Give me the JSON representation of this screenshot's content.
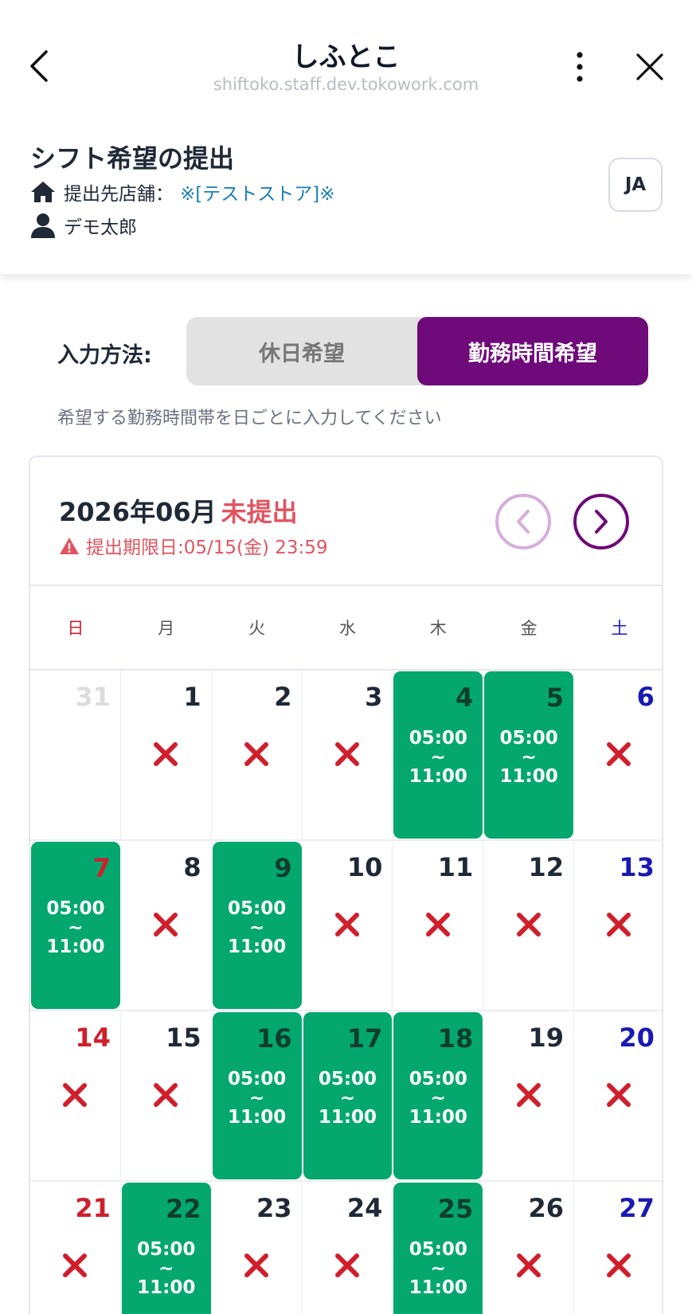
{
  "nav": {
    "title": "しふとこ",
    "url": "shiftoko.staff.dev.tokowork.com"
  },
  "header": {
    "page_title": "シフト希望の提出",
    "store_label": "提出先店舗：",
    "store_name": "※[テストストア]※",
    "user_name": "デモ太郎",
    "lang": "JA"
  },
  "input_method": {
    "label": "入力方法:",
    "options": [
      "休日希望",
      "勤務時間希望"
    ],
    "active_index": 1,
    "hint": "希望する勤務時間帯を日ごとに入力してください"
  },
  "calendar": {
    "month": "2026年06月",
    "status": "未提出",
    "deadline": "提出期限日:05/15(金) 23:59",
    "weekdays": [
      "日",
      "月",
      "火",
      "水",
      "木",
      "金",
      "土"
    ],
    "time_start": "05:00",
    "time_sep": "~",
    "time_end": "11:00",
    "colors": {
      "accent": "#6e0a7a",
      "selected": "#04a86e",
      "off": "#d01f2c",
      "saturday": "#1919b3",
      "warning": "#e05461"
    },
    "weeks": [
      [
        {
          "day": "31",
          "state": "none",
          "other": true
        },
        {
          "day": "1",
          "state": "off"
        },
        {
          "day": "2",
          "state": "off"
        },
        {
          "day": "3",
          "state": "off"
        },
        {
          "day": "4",
          "state": "work"
        },
        {
          "day": "5",
          "state": "work"
        },
        {
          "day": "6",
          "state": "off"
        }
      ],
      [
        {
          "day": "7",
          "state": "work"
        },
        {
          "day": "8",
          "state": "off"
        },
        {
          "day": "9",
          "state": "work"
        },
        {
          "day": "10",
          "state": "off"
        },
        {
          "day": "11",
          "state": "off"
        },
        {
          "day": "12",
          "state": "off"
        },
        {
          "day": "13",
          "state": "off"
        }
      ],
      [
        {
          "day": "14",
          "state": "off"
        },
        {
          "day": "15",
          "state": "off"
        },
        {
          "day": "16",
          "state": "work"
        },
        {
          "day": "17",
          "state": "work"
        },
        {
          "day": "18",
          "state": "work"
        },
        {
          "day": "19",
          "state": "off"
        },
        {
          "day": "20",
          "state": "off"
        }
      ],
      [
        {
          "day": "21",
          "state": "off"
        },
        {
          "day": "22",
          "state": "work"
        },
        {
          "day": "23",
          "state": "off"
        },
        {
          "day": "24",
          "state": "off"
        },
        {
          "day": "25",
          "state": "work"
        },
        {
          "day": "26",
          "state": "off"
        },
        {
          "day": "27",
          "state": "off"
        }
      ]
    ]
  }
}
